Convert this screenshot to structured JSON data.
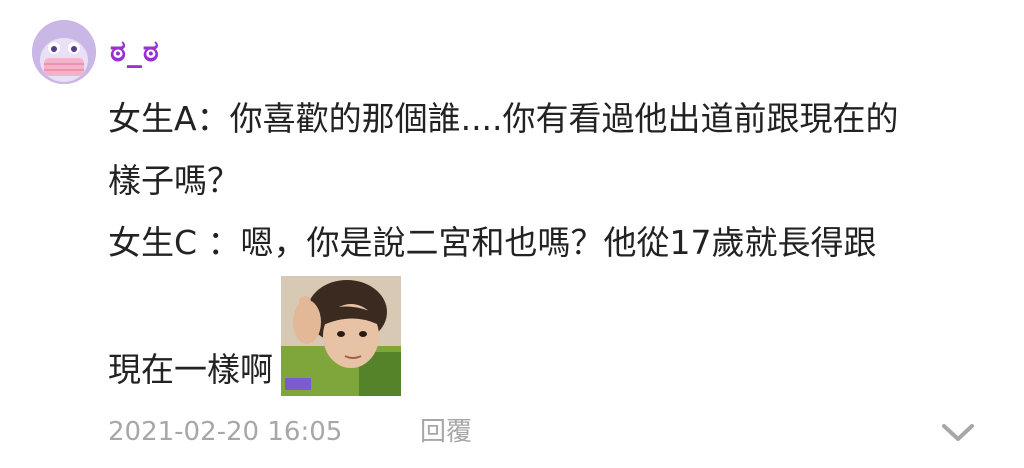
{
  "comment": {
    "username": "ಠ_ಠ",
    "lines": [
      "女生A：你喜歡的那個誰....你有看過他出道前跟現在的",
      "樣子嗎？",
      "女生C ：嗯，你是說二宮和也嗎？他從17歲就長得跟"
    ],
    "last_line": "現在一樣啊",
    "timestamp": "2021-02-20 16:05",
    "reply_label": "回覆",
    "sticker_label": "sticker"
  },
  "colors": {
    "username": "#9b2fd6",
    "avatar_bg": "#c9b7e6",
    "meta": "#a7a7a7"
  },
  "icons": {
    "expand": "chevron-down-icon",
    "avatar": "avatar-icon"
  }
}
